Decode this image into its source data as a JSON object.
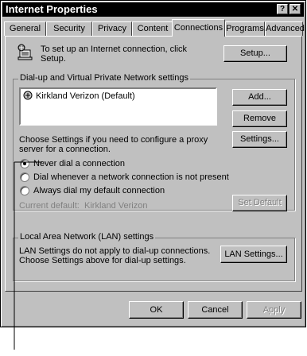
{
  "window": {
    "title": "Internet Properties",
    "help_btn": "?",
    "close_btn": "✕"
  },
  "tabs": [
    {
      "label": "General"
    },
    {
      "label": "Security"
    },
    {
      "label": "Privacy"
    },
    {
      "label": "Content"
    },
    {
      "label": "Connections",
      "active": true
    },
    {
      "label": "Programs"
    },
    {
      "label": "Advanced"
    }
  ],
  "setup": {
    "text_line1": "To set up an Internet connection, click",
    "text_line2": "Setup.",
    "button": "Setup..."
  },
  "dialup": {
    "group_label": "Dial-up and Virtual Private Network settings",
    "list_items": [
      {
        "label": "Kirkland Verizon (Default)"
      }
    ],
    "add_button": "Add...",
    "remove_button": "Remove",
    "proxy_text_line1": "Choose Settings if you need to configure a proxy",
    "proxy_text_line2": "server for a connection.",
    "settings_button": "Settings...",
    "radio_never": "Never dial a connection",
    "radio_whenever": "Dial whenever a network connection is not present",
    "radio_always": "Always dial my default connection",
    "current_default_label": "Current default:",
    "current_default_value": "Kirkland Verizon",
    "set_default_button": "Set Default"
  },
  "lan": {
    "group_label": "Local Area Network (LAN) settings",
    "text_line1": "LAN Settings do not apply to dial-up connections.",
    "text_line2": "Choose Settings above for dial-up settings.",
    "button": "LAN Settings..."
  },
  "footer": {
    "ok": "OK",
    "cancel": "Cancel",
    "apply": "Apply"
  }
}
